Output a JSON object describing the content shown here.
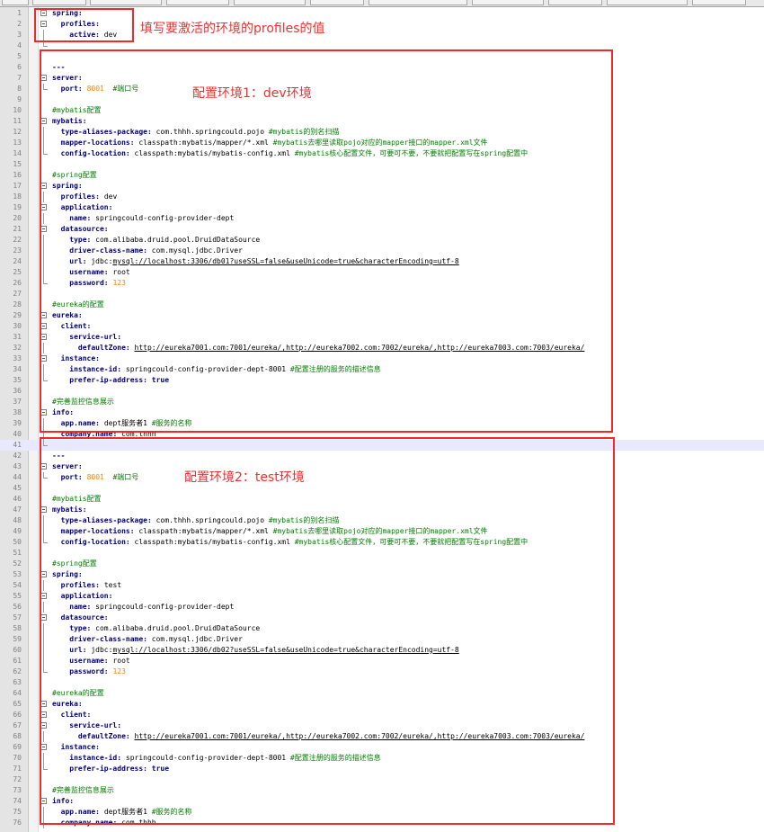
{
  "editor": {
    "lines": [
      {
        "n": "1",
        "fold": "box",
        "t": [
          [
            "k",
            "spring:"
          ]
        ]
      },
      {
        "n": "2",
        "fold": "box",
        "t": [
          [
            "",
            "  "
          ],
          [
            "k",
            "profiles:"
          ]
        ]
      },
      {
        "n": "3",
        "fold": "line",
        "t": [
          [
            "",
            "    "
          ],
          [
            "k",
            "active:"
          ],
          [
            "",
            " dev"
          ]
        ]
      },
      {
        "n": "4",
        "fold": "end",
        "t": []
      },
      {
        "n": "5",
        "fold": "",
        "t": []
      },
      {
        "n": "6",
        "fold": "",
        "t": [
          [
            "k",
            "---"
          ]
        ]
      },
      {
        "n": "7",
        "fold": "box",
        "t": [
          [
            "k",
            "server:"
          ]
        ]
      },
      {
        "n": "8",
        "fold": "end",
        "t": [
          [
            "",
            "  "
          ],
          [
            "k",
            "port:"
          ],
          [
            "",
            " "
          ],
          [
            "num",
            "8001"
          ],
          [
            "",
            "  "
          ],
          [
            "cm",
            "#端口号"
          ]
        ]
      },
      {
        "n": "9",
        "fold": "",
        "t": []
      },
      {
        "n": "10",
        "fold": "",
        "t": [
          [
            "cm",
            "#mybatis配置"
          ]
        ]
      },
      {
        "n": "11",
        "fold": "box",
        "t": [
          [
            "k",
            "mybatis:"
          ]
        ]
      },
      {
        "n": "12",
        "fold": "line",
        "t": [
          [
            "",
            "  "
          ],
          [
            "k",
            "type-aliases-package:"
          ],
          [
            "",
            " com.thhh.springcould.pojo "
          ],
          [
            "cm",
            "#mybatis的别名扫描"
          ]
        ]
      },
      {
        "n": "13",
        "fold": "line",
        "t": [
          [
            "",
            "  "
          ],
          [
            "k",
            "mapper-locations:"
          ],
          [
            "",
            " classpath:mybatis/mapper/*.xml "
          ],
          [
            "cm",
            "#mybatis去哪里读取pojo对应的mapper接口的mapper.xml文件"
          ]
        ]
      },
      {
        "n": "14",
        "fold": "end",
        "t": [
          [
            "",
            "  "
          ],
          [
            "k",
            "config-location:"
          ],
          [
            "",
            " classpath:mybatis/mybatis-config.xml "
          ],
          [
            "cm",
            "#mybatis核心配置文件，可要可不要，不要就把配置写在spring配置中"
          ]
        ]
      },
      {
        "n": "15",
        "fold": "",
        "t": []
      },
      {
        "n": "16",
        "fold": "",
        "t": [
          [
            "cm",
            "#spring配置"
          ]
        ]
      },
      {
        "n": "17",
        "fold": "box",
        "t": [
          [
            "k",
            "spring:"
          ]
        ]
      },
      {
        "n": "18",
        "fold": "line",
        "t": [
          [
            "",
            "  "
          ],
          [
            "k",
            "profiles:"
          ],
          [
            "",
            " dev"
          ]
        ]
      },
      {
        "n": "19",
        "fold": "box",
        "t": [
          [
            "",
            "  "
          ],
          [
            "k",
            "application:"
          ]
        ]
      },
      {
        "n": "20",
        "fold": "line",
        "t": [
          [
            "",
            "    "
          ],
          [
            "k",
            "name:"
          ],
          [
            "",
            " springcould-config-provider-dept"
          ]
        ]
      },
      {
        "n": "21",
        "fold": "box",
        "t": [
          [
            "",
            "  "
          ],
          [
            "k",
            "datasource:"
          ]
        ]
      },
      {
        "n": "22",
        "fold": "line",
        "t": [
          [
            "",
            "    "
          ],
          [
            "k",
            "type:"
          ],
          [
            "",
            " com.alibaba.druid.pool.DruidDataSource"
          ]
        ]
      },
      {
        "n": "23",
        "fold": "line",
        "t": [
          [
            "",
            "    "
          ],
          [
            "k",
            "driver-class-name:"
          ],
          [
            "",
            " com.mysql.jdbc.Driver"
          ]
        ]
      },
      {
        "n": "24",
        "fold": "line",
        "t": [
          [
            "",
            "    "
          ],
          [
            "k",
            "url:"
          ],
          [
            "",
            " jdbc:"
          ],
          [
            "u",
            "mysql://localhost:3306/db01?useSSL=false&useUnicode=true&characterEncoding=utf-8"
          ]
        ]
      },
      {
        "n": "25",
        "fold": "line",
        "t": [
          [
            "",
            "    "
          ],
          [
            "k",
            "username:"
          ],
          [
            "",
            " root"
          ]
        ]
      },
      {
        "n": "26",
        "fold": "end",
        "t": [
          [
            "",
            "    "
          ],
          [
            "k",
            "password:"
          ],
          [
            "",
            " "
          ],
          [
            "num",
            "123"
          ]
        ]
      },
      {
        "n": "27",
        "fold": "",
        "t": []
      },
      {
        "n": "28",
        "fold": "",
        "t": [
          [
            "cm",
            "#eureka的配置"
          ]
        ]
      },
      {
        "n": "29",
        "fold": "box",
        "t": [
          [
            "k",
            "eureka:"
          ]
        ]
      },
      {
        "n": "30",
        "fold": "box",
        "t": [
          [
            "",
            "  "
          ],
          [
            "k",
            "client:"
          ]
        ]
      },
      {
        "n": "31",
        "fold": "box",
        "t": [
          [
            "",
            "    "
          ],
          [
            "k",
            "service-url:"
          ]
        ]
      },
      {
        "n": "32",
        "fold": "line",
        "t": [
          [
            "",
            "      "
          ],
          [
            "k",
            "defaultZone:"
          ],
          [
            "",
            " "
          ],
          [
            "u",
            "http://eureka7001.com:7001/eureka/,http://eureka7002.com:7002/eureka/,http://eureka7003.com:7003/eureka/"
          ]
        ]
      },
      {
        "n": "33",
        "fold": "box",
        "t": [
          [
            "",
            "  "
          ],
          [
            "k",
            "instance:"
          ]
        ]
      },
      {
        "n": "34",
        "fold": "line",
        "t": [
          [
            "",
            "    "
          ],
          [
            "k",
            "instance-id:"
          ],
          [
            "",
            " springcould-config-provider-dept-8001 "
          ],
          [
            "cm",
            "#配置注册的服务的描述信息"
          ]
        ]
      },
      {
        "n": "35",
        "fold": "end",
        "t": [
          [
            "",
            "    "
          ],
          [
            "k",
            "prefer-ip-address:"
          ],
          [
            "",
            " "
          ],
          [
            "k",
            "true"
          ]
        ]
      },
      {
        "n": "36",
        "fold": "",
        "t": []
      },
      {
        "n": "37",
        "fold": "",
        "t": [
          [
            "cm",
            "#完善监控信息展示"
          ]
        ]
      },
      {
        "n": "38",
        "fold": "box",
        "t": [
          [
            "k",
            "info:"
          ]
        ]
      },
      {
        "n": "39",
        "fold": "line",
        "t": [
          [
            "",
            "  "
          ],
          [
            "k",
            "app.name:"
          ],
          [
            "",
            " dept服务者1 "
          ],
          [
            "cm",
            "#服务的名称"
          ]
        ]
      },
      {
        "n": "40",
        "fold": "line",
        "t": [
          [
            "",
            "  "
          ],
          [
            "k",
            "company.name:"
          ],
          [
            "",
            " com.thhh"
          ]
        ]
      },
      {
        "n": "41",
        "fold": "end",
        "current": true,
        "t": []
      },
      {
        "n": "42",
        "fold": "",
        "t": [
          [
            "k",
            "---"
          ]
        ]
      },
      {
        "n": "43",
        "fold": "box",
        "t": [
          [
            "k",
            "server:"
          ]
        ]
      },
      {
        "n": "44",
        "fold": "end",
        "t": [
          [
            "",
            "  "
          ],
          [
            "k",
            "port:"
          ],
          [
            "",
            " "
          ],
          [
            "num",
            "8001"
          ],
          [
            "",
            "  "
          ],
          [
            "cm",
            "#端口号"
          ]
        ]
      },
      {
        "n": "45",
        "fold": "",
        "t": []
      },
      {
        "n": "46",
        "fold": "",
        "t": [
          [
            "cm",
            "#mybatis配置"
          ]
        ]
      },
      {
        "n": "47",
        "fold": "box",
        "t": [
          [
            "k",
            "mybatis:"
          ]
        ]
      },
      {
        "n": "48",
        "fold": "line",
        "t": [
          [
            "",
            "  "
          ],
          [
            "k",
            "type-aliases-package:"
          ],
          [
            "",
            " com.thhh.springcould.pojo "
          ],
          [
            "cm",
            "#mybatis的别名扫描"
          ]
        ]
      },
      {
        "n": "49",
        "fold": "line",
        "t": [
          [
            "",
            "  "
          ],
          [
            "k",
            "mapper-locations:"
          ],
          [
            "",
            " classpath:mybatis/mapper/*.xml "
          ],
          [
            "cm",
            "#mybatis去哪里读取pojo对应的mapper接口的mapper.xml文件"
          ]
        ]
      },
      {
        "n": "50",
        "fold": "end",
        "t": [
          [
            "",
            "  "
          ],
          [
            "k",
            "config-location:"
          ],
          [
            "",
            " classpath:mybatis/mybatis-config.xml "
          ],
          [
            "cm",
            "#mybatis核心配置文件，可要可不要，不要就把配置写在spring配置中"
          ]
        ]
      },
      {
        "n": "51",
        "fold": "",
        "t": []
      },
      {
        "n": "52",
        "fold": "",
        "t": [
          [
            "cm",
            "#spring配置"
          ]
        ]
      },
      {
        "n": "53",
        "fold": "box",
        "t": [
          [
            "k",
            "spring:"
          ]
        ]
      },
      {
        "n": "54",
        "fold": "line",
        "t": [
          [
            "",
            "  "
          ],
          [
            "k",
            "profiles:"
          ],
          [
            "",
            " test"
          ]
        ]
      },
      {
        "n": "55",
        "fold": "box",
        "t": [
          [
            "",
            "  "
          ],
          [
            "k",
            "application:"
          ]
        ]
      },
      {
        "n": "56",
        "fold": "line",
        "t": [
          [
            "",
            "    "
          ],
          [
            "k",
            "name:"
          ],
          [
            "",
            " springcould-config-provider-dept"
          ]
        ]
      },
      {
        "n": "57",
        "fold": "box",
        "t": [
          [
            "",
            "  "
          ],
          [
            "k",
            "datasource:"
          ]
        ]
      },
      {
        "n": "58",
        "fold": "line",
        "t": [
          [
            "",
            "    "
          ],
          [
            "k",
            "type:"
          ],
          [
            "",
            " com.alibaba.druid.pool.DruidDataSource"
          ]
        ]
      },
      {
        "n": "59",
        "fold": "line",
        "t": [
          [
            "",
            "    "
          ],
          [
            "k",
            "driver-class-name:"
          ],
          [
            "",
            " com.mysql.jdbc.Driver"
          ]
        ]
      },
      {
        "n": "60",
        "fold": "line",
        "t": [
          [
            "",
            "    "
          ],
          [
            "k",
            "url:"
          ],
          [
            "",
            " jdbc:"
          ],
          [
            "u",
            "mysql://localhost:3306/db02?useSSL=false&useUnicode=true&characterEncoding=utf-8"
          ]
        ]
      },
      {
        "n": "61",
        "fold": "line",
        "t": [
          [
            "",
            "    "
          ],
          [
            "k",
            "username:"
          ],
          [
            "",
            " root"
          ]
        ]
      },
      {
        "n": "62",
        "fold": "end",
        "t": [
          [
            "",
            "    "
          ],
          [
            "k",
            "password:"
          ],
          [
            "",
            " "
          ],
          [
            "num",
            "123"
          ]
        ]
      },
      {
        "n": "63",
        "fold": "",
        "t": []
      },
      {
        "n": "64",
        "fold": "",
        "t": [
          [
            "cm",
            "#eureka的配置"
          ]
        ]
      },
      {
        "n": "65",
        "fold": "box",
        "t": [
          [
            "k",
            "eureka:"
          ]
        ]
      },
      {
        "n": "66",
        "fold": "box",
        "t": [
          [
            "",
            "  "
          ],
          [
            "k",
            "client:"
          ]
        ]
      },
      {
        "n": "67",
        "fold": "box",
        "t": [
          [
            "",
            "    "
          ],
          [
            "k",
            "service-url:"
          ]
        ]
      },
      {
        "n": "68",
        "fold": "line",
        "t": [
          [
            "",
            "      "
          ],
          [
            "k",
            "defaultZone:"
          ],
          [
            "",
            " "
          ],
          [
            "u",
            "http://eureka7001.com:7001/eureka/,http://eureka7002.com:7002/eureka/,http://eureka7003.com:7003/eureka/"
          ]
        ]
      },
      {
        "n": "69",
        "fold": "box",
        "t": [
          [
            "",
            "  "
          ],
          [
            "k",
            "instance:"
          ]
        ]
      },
      {
        "n": "70",
        "fold": "line",
        "t": [
          [
            "",
            "    "
          ],
          [
            "k",
            "instance-id:"
          ],
          [
            "",
            " springcould-config-provider-dept-8001 "
          ],
          [
            "cm",
            "#配置注册的服务的描述信息"
          ]
        ]
      },
      {
        "n": "71",
        "fold": "end",
        "t": [
          [
            "",
            "    "
          ],
          [
            "k",
            "prefer-ip-address:"
          ],
          [
            "",
            " "
          ],
          [
            "k",
            "true"
          ]
        ]
      },
      {
        "n": "72",
        "fold": "",
        "t": []
      },
      {
        "n": "73",
        "fold": "",
        "t": [
          [
            "cm",
            "#完善监控信息展示"
          ]
        ]
      },
      {
        "n": "74",
        "fold": "box",
        "t": [
          [
            "k",
            "info:"
          ]
        ]
      },
      {
        "n": "75",
        "fold": "line",
        "t": [
          [
            "",
            "  "
          ],
          [
            "k",
            "app.name:"
          ],
          [
            "",
            " dept服务者1 "
          ],
          [
            "cm",
            "#服务的名称"
          ]
        ]
      },
      {
        "n": "76",
        "fold": "line",
        "t": [
          [
            "",
            "  "
          ],
          [
            "k",
            "company.name:"
          ],
          [
            "",
            " com.thhh"
          ]
        ]
      }
    ]
  },
  "annotations": {
    "profiles_note": "填写要激活的环境的profiles的值",
    "env1_note": "配置环境1：dev环境",
    "env2_note": "配置环境2：test环境"
  },
  "colors": {
    "annotation_red": "#ee2a2a",
    "keyword": "#000080",
    "number": "#ff8000",
    "comment": "#008000",
    "current_line": "#e8e8ff"
  }
}
